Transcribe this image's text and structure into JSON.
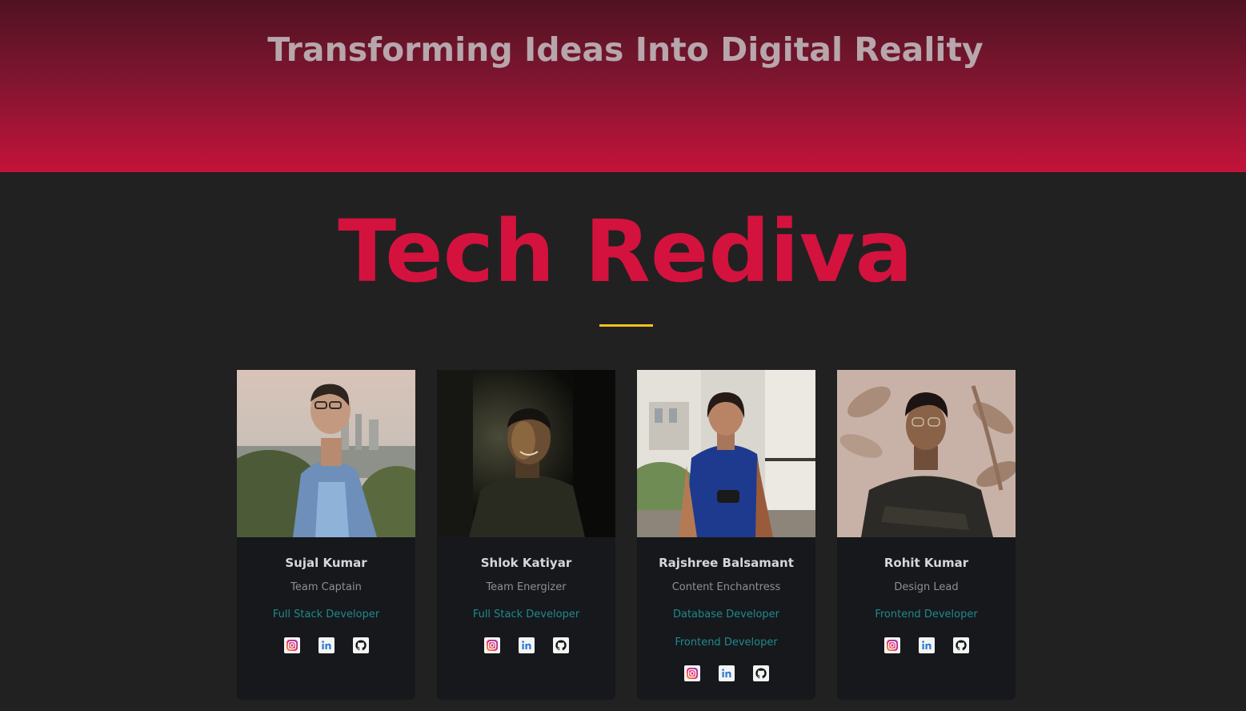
{
  "hero": {
    "title": "Transforming Ideas Into Digital Reality"
  },
  "brand": {
    "name": "Tech Rediva"
  },
  "colors": {
    "accent": "#d4123e",
    "divider": "#f2c31b",
    "skill": "#1f8a8c"
  },
  "team": [
    {
      "name": "Sujal Kumar",
      "role": "Team Captain",
      "skills": [
        "Full Stack Developer"
      ],
      "socials": [
        "instagram-icon",
        "linkedin-icon",
        "github-icon"
      ]
    },
    {
      "name": "Shlok Katiyar",
      "role": "Team Energizer",
      "skills": [
        "Full Stack Developer"
      ],
      "socials": [
        "instagram-icon",
        "linkedin-icon",
        "github-icon"
      ]
    },
    {
      "name": "Rajshree Balsamant",
      "role": "Content Enchantress",
      "skills": [
        "Database Developer",
        "Frontend Developer"
      ],
      "socials": [
        "instagram-icon",
        "linkedin-icon",
        "github-icon"
      ]
    },
    {
      "name": "Rohit Kumar",
      "role": "Design Lead",
      "skills": [
        "Frontend Developer"
      ],
      "socials": [
        "instagram-icon",
        "linkedin-icon",
        "github-icon"
      ]
    }
  ]
}
